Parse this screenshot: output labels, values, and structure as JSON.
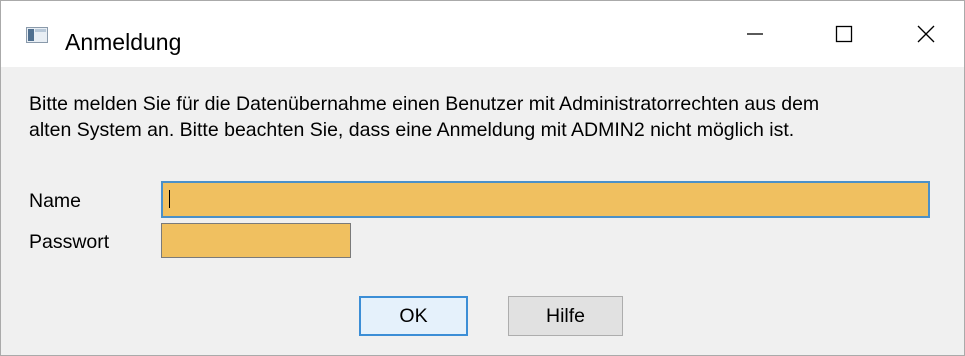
{
  "window": {
    "title": "Anmeldung",
    "icon": "window-app-icon"
  },
  "message": {
    "line1": "Bitte melden Sie für die Datenübernahme einen Benutzer mit Administratorrechten aus dem",
    "line2": "alten System an. Bitte beachten Sie, dass eine Anmeldung mit ADMIN2 nicht möglich ist."
  },
  "form": {
    "name_label": "Name",
    "name_value": "",
    "password_label": "Passwort",
    "password_value": "",
    "field_color": "#f0c060"
  },
  "buttons": {
    "ok_label": "OK",
    "help_label": "Hilfe"
  },
  "colors": {
    "focus_border": "#3c8ed6"
  }
}
